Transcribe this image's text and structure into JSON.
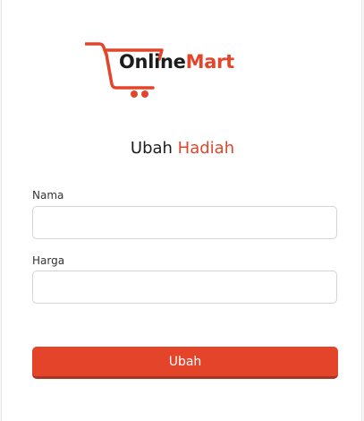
{
  "logo": {
    "text_online": "Online",
    "text_mart": "Mart",
    "icon": "shopping-cart-icon",
    "colors": {
      "accent": "#e4452a",
      "dark": "#1c1c1c"
    }
  },
  "form": {
    "title_prefix": "Ubah",
    "title_accent": "Hadiah",
    "fields": [
      {
        "label": "Nama",
        "value": "",
        "placeholder": ""
      },
      {
        "label": "Harga",
        "value": "",
        "placeholder": ""
      }
    ],
    "submit_label": "Ubah"
  }
}
